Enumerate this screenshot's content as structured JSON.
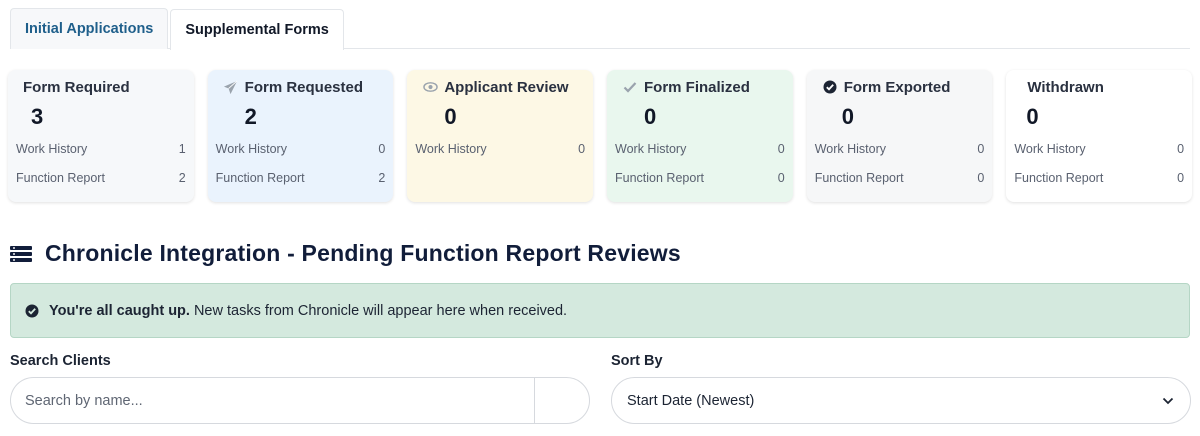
{
  "tabs": [
    {
      "label": "Initial Applications",
      "active": false
    },
    {
      "label": "Supplemental Forms",
      "active": true
    }
  ],
  "cards": [
    {
      "title": "Form Required",
      "count": "3",
      "icon": "none",
      "bg": "#f6f8fa",
      "rows": [
        {
          "label": "Work History",
          "value": "1"
        },
        {
          "label": "Function Report",
          "value": "2"
        }
      ]
    },
    {
      "title": "Form Requested",
      "count": "2",
      "icon": "paper-plane-icon",
      "bg": "#eaf3fd",
      "rows": [
        {
          "label": "Work History",
          "value": "0"
        },
        {
          "label": "Function Report",
          "value": "2"
        }
      ]
    },
    {
      "title": "Applicant Review",
      "count": "0",
      "icon": "eye-icon",
      "bg": "#fdf8e5",
      "rows": [
        {
          "label": "Work History",
          "value": "0"
        }
      ]
    },
    {
      "title": "Form Finalized",
      "count": "0",
      "icon": "check-icon",
      "bg": "#e9f7ee",
      "rows": [
        {
          "label": "Work History",
          "value": "0"
        },
        {
          "label": "Function Report",
          "value": "0"
        }
      ]
    },
    {
      "title": "Form Exported",
      "count": "0",
      "icon": "check-circle-icon",
      "bg": "#f6f7f8",
      "rows": [
        {
          "label": "Work History",
          "value": "0"
        },
        {
          "label": "Function Report",
          "value": "0"
        }
      ]
    },
    {
      "title": "Withdrawn",
      "count": "0",
      "icon": "none",
      "bg": "#ffffff",
      "rows": [
        {
          "label": "Work History",
          "value": "0"
        },
        {
          "label": "Function Report",
          "value": "0"
        }
      ]
    }
  ],
  "section": {
    "title": "Chronicle Integration - Pending Function Report Reviews",
    "icon": "list-icon"
  },
  "alert": {
    "strong": "You're all caught up.",
    "message": "New tasks from Chronicle will appear here when received.",
    "icon": "check-circle-icon"
  },
  "search": {
    "label": "Search Clients",
    "placeholder": "Search by name...",
    "value": ""
  },
  "sort": {
    "label": "Sort By",
    "selected": "Start Date (Newest)"
  },
  "colors": {
    "tab_inactive_text": "#1f5f8b",
    "alert_bg": "#d4e9de",
    "heading": "#111d3a"
  }
}
